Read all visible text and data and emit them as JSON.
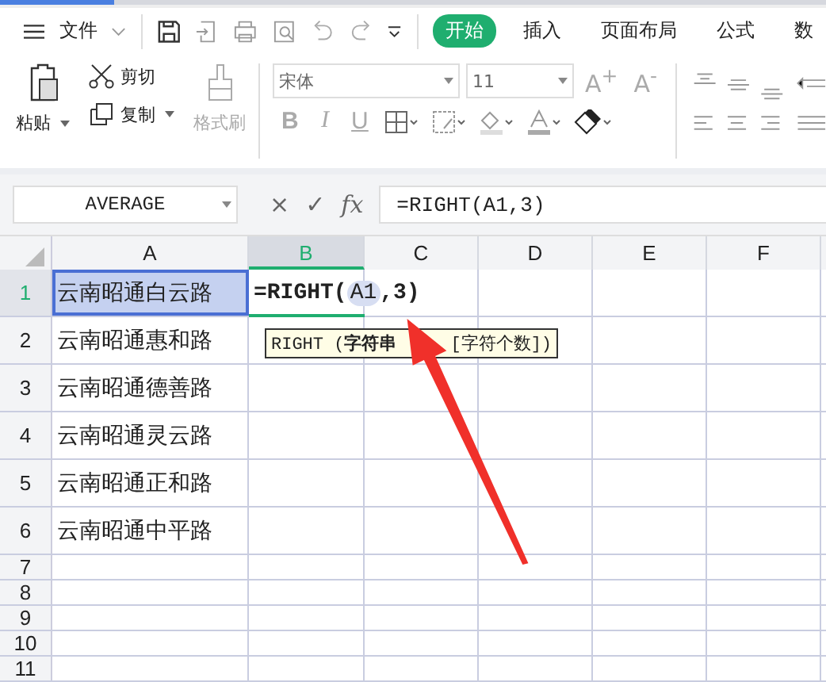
{
  "menu": {
    "label": "文件"
  },
  "tabs": [
    {
      "label": "开始",
      "selected": true
    },
    {
      "label": "插入",
      "selected": false
    },
    {
      "label": "页面布局",
      "selected": false
    },
    {
      "label": "公式",
      "selected": false
    },
    {
      "label": "数",
      "selected": false
    }
  ],
  "ribbon": {
    "paste": "粘贴",
    "cut": "剪切",
    "copy": "复制",
    "format_painter": "格式刷",
    "font": "宋体",
    "size": "11",
    "grow": "A$^{+}$",
    "shrink": "A$^{-}$",
    "bold": "B",
    "italic": "I",
    "underline": "U"
  },
  "formula_bar": {
    "name_box": "AVERAGE",
    "cancel": "×",
    "confirm": "✓",
    "fx": "fx",
    "formula": "=RIGHT(A1,3)"
  },
  "columns": [
    {
      "label": "A",
      "selected": false
    },
    {
      "label": "B",
      "selected": true
    },
    {
      "label": "C",
      "selected": false
    },
    {
      "label": "D",
      "selected": false
    },
    {
      "label": "E",
      "selected": false
    },
    {
      "label": "F",
      "selected": false
    }
  ],
  "rows": [
    {
      "label": "1",
      "selected": true,
      "a": "云南昭通白云路"
    },
    {
      "label": "2",
      "selected": false,
      "a": "云南昭通惠和路"
    },
    {
      "label": "3",
      "selected": false,
      "a": "云南昭通德善路"
    },
    {
      "label": "4",
      "selected": false,
      "a": "云南昭通灵云路"
    },
    {
      "label": "5",
      "selected": false,
      "a": "云南昭通正和路"
    },
    {
      "label": "6",
      "selected": false,
      "a": "云南昭通中平路"
    },
    {
      "label": "7",
      "selected": false
    },
    {
      "label": "8",
      "selected": false
    },
    {
      "label": "9",
      "selected": false
    },
    {
      "label": "10",
      "selected": false
    },
    {
      "label": "11",
      "selected": false
    }
  ],
  "editing_cell": {
    "prefix": "=RIGHT(",
    "ref": "A1",
    "suffix": ",3)"
  },
  "tooltip": {
    "function": "RIGHT (**字符串**",
    "args": "[字符个数])"
  }
}
